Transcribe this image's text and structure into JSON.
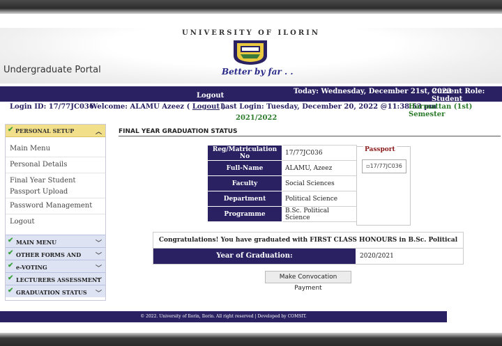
{
  "header": {
    "university": "UNIVERSITY OF ILORIN",
    "motto": "Better by far . .",
    "portal_title": "Undergraduate Portal"
  },
  "nav": {
    "logout": "Logout",
    "today": "Today: Wednesday, December 21st, 2022",
    "role": "Current Role: Student"
  },
  "info": {
    "login_id": "Login ID: 17/77JC036",
    "welcome": "Welcome: ALAMU Azeez (",
    "welcome_logout": "Logout",
    "welcome_close": ")",
    "last_login": "Last Login: Tuesday, December 20, 2022 @11:38:53 pm",
    "session": "2021/2022",
    "semester": "Harmattan (1st) Semester"
  },
  "sidebar": {
    "personal_setup": "PERSONAL SETUP",
    "links": [
      "Main Menu",
      "Personal Details",
      "Final Year Student Passport Upload",
      "Password Management",
      "Logout"
    ],
    "sections": [
      "MAIN MENU",
      "OTHER FORMS AND PAYMENTS",
      "e-VOTING",
      "LECTURERS ASSESSMENT",
      "GRADUATION STATUS"
    ]
  },
  "main": {
    "title": "FINAL YEAR GRADUATION STATUS",
    "rows": [
      {
        "label": "Reg/Matriculation No",
        "value": "17/77JC036"
      },
      {
        "label": "Full-Name",
        "value": "ALAMU, Azeez"
      },
      {
        "label": "Faculty",
        "value": "Social Sciences"
      },
      {
        "label": "Department",
        "value": "Political Science"
      },
      {
        "label": "Programme",
        "value": "B.Sc. Political Science"
      }
    ],
    "passport_legend": "Passport",
    "passport_alt": "17/77JC036",
    "congrats": "Congratulations! You have graduated with FIRST CLASS HONOURS in B.Sc. Political Science.",
    "year_label": "Year of Graduation:",
    "year_value": "2020/2021",
    "button": "Make Convocation Payment"
  },
  "footer": "© 2022. University of Ilorin, Ilorin. All right reserved | Developed by COMSIT."
}
